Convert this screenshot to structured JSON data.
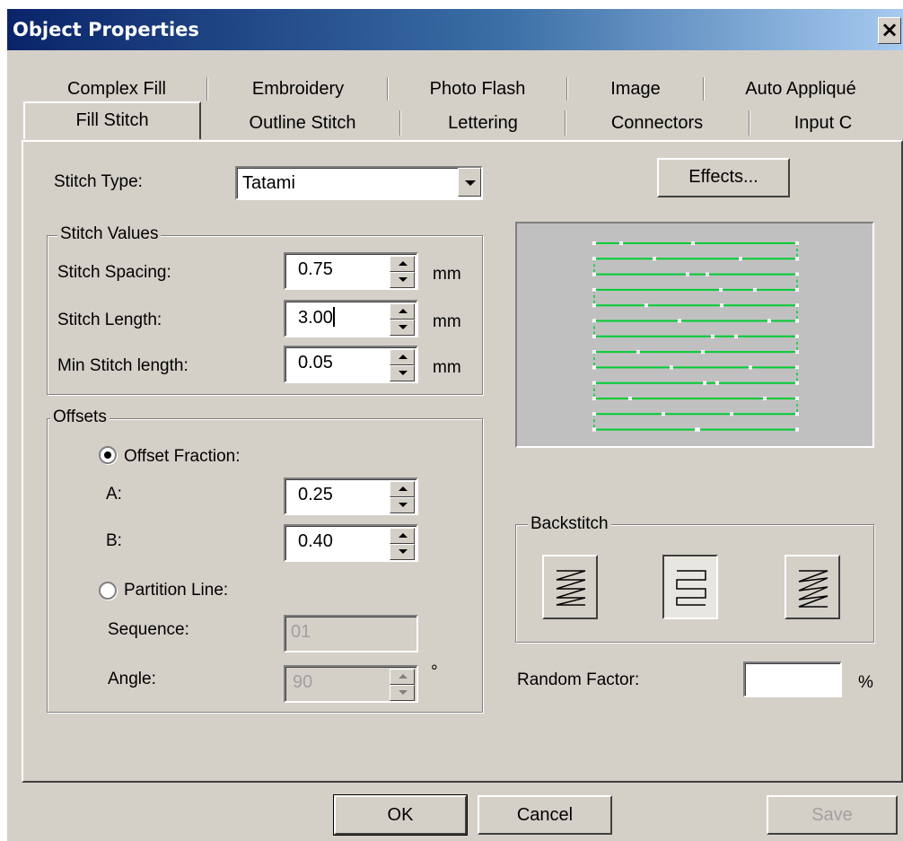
{
  "window": {
    "title": "Object Properties",
    "close_label": "×"
  },
  "tabs": {
    "back_row": [
      "Complex Fill",
      "Embroidery",
      "Photo Flash",
      "Image",
      "Auto Appliqué"
    ],
    "front_row": [
      "Fill Stitch",
      "Outline Stitch",
      "Lettering",
      "Connectors",
      "Input C"
    ],
    "active": "Fill Stitch"
  },
  "stitch_type": {
    "label": "Stitch Type:",
    "value": "Tatami"
  },
  "effects_button": "Effects...",
  "stitch_values": {
    "title": "Stitch Values",
    "rows": [
      {
        "label": "Stitch Spacing:",
        "value": "0.75",
        "unit": "mm"
      },
      {
        "label": "Stitch Length:",
        "value": "3.00",
        "unit": "mm"
      },
      {
        "label": "Min Stitch length:",
        "value": "0.05",
        "unit": "mm"
      }
    ]
  },
  "offsets": {
    "title": "Offsets",
    "offset_fraction_label": "Offset Fraction:",
    "a_label": "A:",
    "a_value": "0.25",
    "b_label": "B:",
    "b_value": "0.40",
    "partition_line_label": "Partition Line:",
    "sequence_label": "Sequence:",
    "sequence_value": "01",
    "angle_label": "Angle:",
    "angle_value": "90",
    "angle_unit": "°",
    "selected": "Offset Fraction"
  },
  "backstitch": {
    "title": "Backstitch",
    "selected_index": 1
  },
  "random_factor": {
    "label": "Random Factor:",
    "value": "",
    "unit": "%"
  },
  "buttons": {
    "ok": "OK",
    "cancel": "Cancel",
    "save": "Save"
  },
  "colors": {
    "dialog_bg": "#d4d0c8",
    "title_gradient_start": "#0a246a",
    "title_gradient_end": "#a6caf0",
    "stitch_line": "#00cc33",
    "preview_bg": "#c0c0c0"
  }
}
